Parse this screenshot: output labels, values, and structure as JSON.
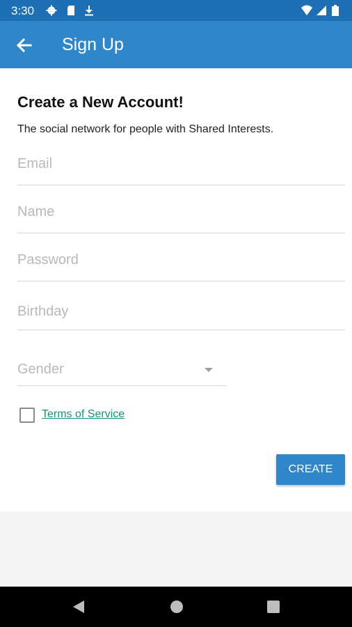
{
  "status_bar": {
    "time": "3:30",
    "left_icons": [
      "gear-icon",
      "sd-card-icon",
      "download-icon"
    ],
    "right_icons": [
      "wifi-icon",
      "signal-icon",
      "battery-icon"
    ]
  },
  "app_bar": {
    "title": "Sign Up",
    "back_icon": "arrow-left-icon",
    "background": "#2f86c8"
  },
  "form": {
    "heading": "Create a New Account!",
    "subtitle": "The social network for people with Shared Interests.",
    "fields": {
      "email": {
        "placeholder": "Email",
        "value": ""
      },
      "name": {
        "placeholder": "Name",
        "value": ""
      },
      "password": {
        "placeholder": "Password",
        "value": ""
      },
      "birthday": {
        "placeholder": "Birthday",
        "value": ""
      }
    },
    "gender": {
      "placeholder": "Gender",
      "value": ""
    },
    "terms": {
      "label": "Terms of Service",
      "checked": false
    },
    "submit_label": "CREATE"
  },
  "colors": {
    "primary": "#2f86c8",
    "status_bar": "#1e6fb3",
    "link": "#14907e"
  },
  "nav_bar": {
    "icons": [
      "back-triangle-icon",
      "home-circle-icon",
      "recents-square-icon"
    ]
  }
}
